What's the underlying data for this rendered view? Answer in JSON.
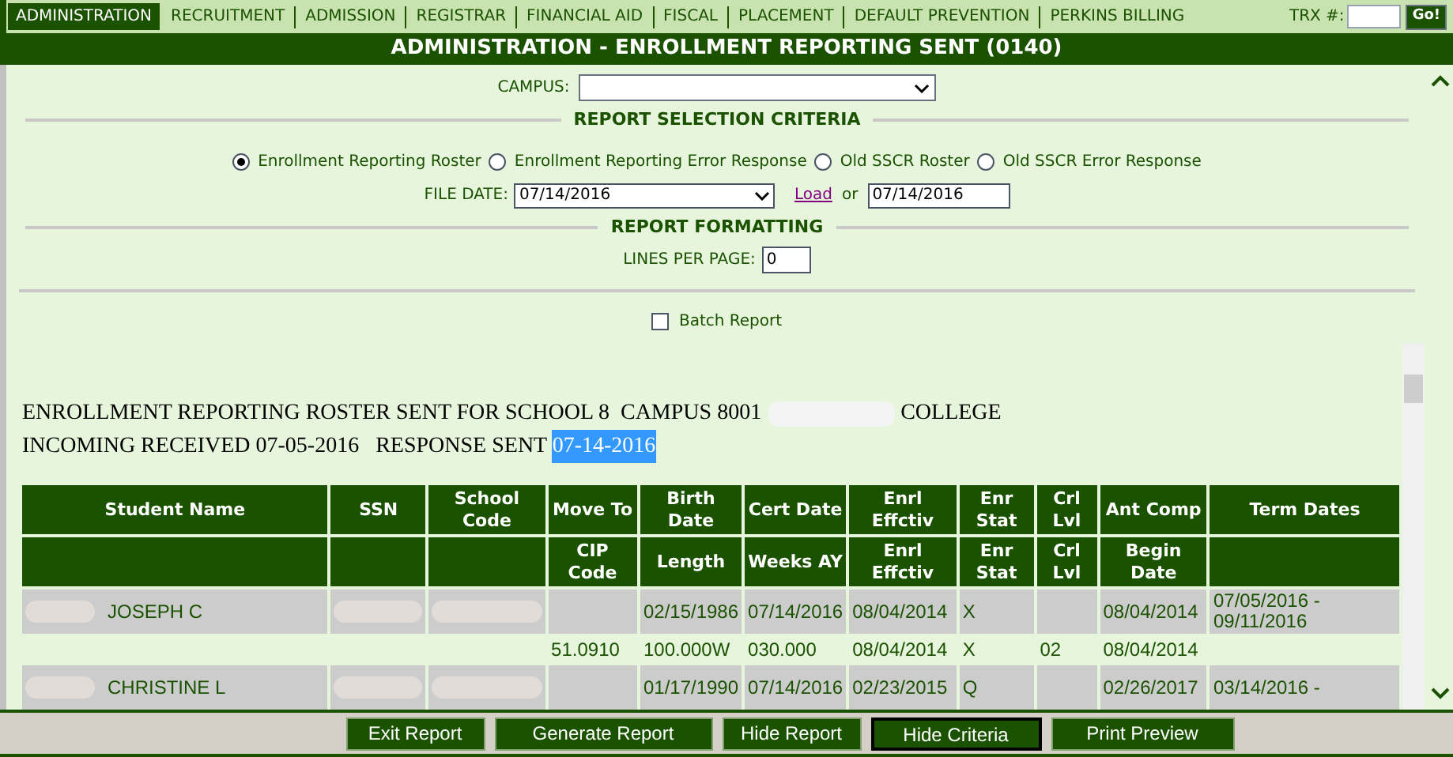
{
  "nav": {
    "tabs": [
      {
        "label": "ADMINISTRATION",
        "selected": true
      },
      {
        "label": "RECRUITMENT",
        "selected": false
      },
      {
        "label": "ADMISSION",
        "selected": false
      },
      {
        "label": "REGISTRAR",
        "selected": false
      },
      {
        "label": "FINANCIAL AID",
        "selected": false
      },
      {
        "label": "FISCAL",
        "selected": false
      },
      {
        "label": "PLACEMENT",
        "selected": false
      },
      {
        "label": "DEFAULT PREVENTION",
        "selected": false
      },
      {
        "label": "PERKINS BILLING",
        "selected": false
      }
    ],
    "trx_label": "TRX #:",
    "go_button": "Go!"
  },
  "title": "ADMINISTRATION - ENROLLMENT REPORTING SENT (0140)",
  "campus": {
    "label": "CAMPUS:"
  },
  "selection": {
    "heading": "REPORT SELECTION CRITERIA",
    "options": [
      {
        "label": "Enrollment Reporting Roster",
        "selected": true
      },
      {
        "label": "Enrollment Reporting Error Response",
        "selected": false
      },
      {
        "label": "Old SSCR Roster",
        "selected": false
      },
      {
        "label": "Old SSCR Error Response",
        "selected": false
      }
    ],
    "file_date_label": "FILE DATE:",
    "file_date": "07/14/2016",
    "load_link": "Load",
    "or_text": "or",
    "date_value": "07/14/2016"
  },
  "formatting": {
    "heading": "REPORT FORMATTING",
    "lines_label": "LINES PER PAGE:",
    "lines_value": "0"
  },
  "batch_report": {
    "label": "Batch Report",
    "checked": false
  },
  "report": {
    "lines": [
      [
        {
          "kind": "text",
          "text": "ENROLLMENT REPORTING ROSTER SENT FOR SCHOOL 8  CAMPUS 8001"
        },
        {
          "kind": "redacted"
        },
        {
          "kind": "text",
          "text": "COLLEGE"
        }
      ],
      [
        {
          "kind": "text",
          "text": "INCOMING RECEIVED 07-05-2016   RESPONSE SENT "
        },
        {
          "kind": "highlighted",
          "text": "07-14-2016"
        }
      ]
    ],
    "table": {
      "header_rows": [
        [
          "Student Name",
          "SSN",
          "School Code",
          "Move To",
          "Birth Date",
          "Cert Date",
          "Enrl Effctiv",
          "Enr Stat",
          "Crl Lvl",
          "Ant Comp",
          "Term Dates"
        ],
        [
          "",
          "",
          "",
          "CIP Code",
          "Length",
          "Weeks AY",
          "Enrl Effctiv",
          "Enr Stat",
          "Crl Lvl",
          "Begin Date",
          ""
        ]
      ],
      "rows": [
        {
          "kind": "student",
          "cells": [
            {
              "text": "JOSEPH C",
              "redacted": true
            },
            {
              "text": "",
              "redacted": true
            },
            {
              "text": "",
              "redacted": true
            },
            {
              "text": ""
            },
            {
              "text": "02/15/1986"
            },
            {
              "text": "07/14/2016"
            },
            {
              "text": "08/04/2014"
            },
            {
              "text": "X"
            },
            {
              "text": ""
            },
            {
              "text": "08/04/2014"
            },
            {
              "text": "07/05/2016 - 09/11/2016"
            }
          ]
        },
        {
          "kind": "detail",
          "cells": [
            {
              "text": ""
            },
            {
              "text": ""
            },
            {
              "text": ""
            },
            {
              "text": "51.0910"
            },
            {
              "text": "100.000W"
            },
            {
              "text": "030.000"
            },
            {
              "text": "08/04/2014"
            },
            {
              "text": "X"
            },
            {
              "text": "02"
            },
            {
              "text": "08/04/2014"
            },
            {
              "text": ""
            }
          ]
        },
        {
          "kind": "student",
          "cells": [
            {
              "text": "CHRISTINE L",
              "redacted": true
            },
            {
              "text": "",
              "redacted": true
            },
            {
              "text": "",
              "redacted": true
            },
            {
              "text": ""
            },
            {
              "text": "01/17/1990"
            },
            {
              "text": "07/14/2016"
            },
            {
              "text": "02/23/2015"
            },
            {
              "text": "Q"
            },
            {
              "text": ""
            },
            {
              "text": "02/26/2017"
            },
            {
              "text": "03/14/2016 -"
            }
          ]
        }
      ]
    }
  },
  "buttons": [
    {
      "label": "Exit Report",
      "focused": false
    },
    {
      "label": "Generate Report",
      "focused": false
    },
    {
      "label": "Hide Report",
      "focused": false
    },
    {
      "label": "Hide Criteria",
      "focused": true
    },
    {
      "label": "Print Preview",
      "focused": false
    }
  ]
}
